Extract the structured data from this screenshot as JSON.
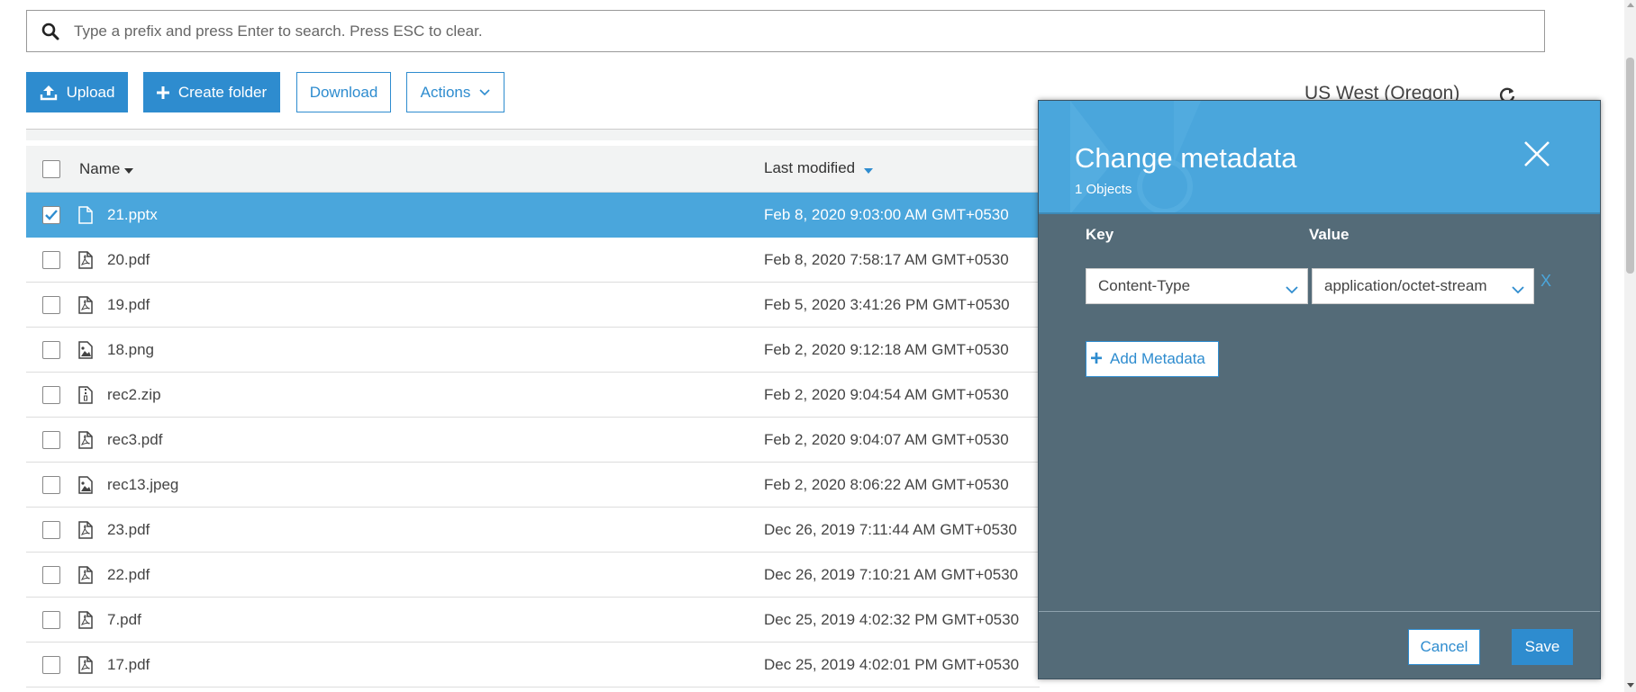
{
  "search": {
    "placeholder": "Type a prefix and press Enter to search. Press ESC to clear."
  },
  "toolbar": {
    "upload_label": "Upload",
    "create_folder_label": "Create folder",
    "download_label": "Download",
    "actions_label": "Actions"
  },
  "region": "US West (Oregon)",
  "table": {
    "headers": {
      "name": "Name",
      "last_modified": "Last modified"
    },
    "rows": [
      {
        "name": "21.pptx",
        "date": "Feb 8, 2020 9:03:00 AM GMT+0530",
        "icon": "document-icon",
        "selected": true
      },
      {
        "name": "20.pdf",
        "date": "Feb 8, 2020 7:58:17 AM GMT+0530",
        "icon": "pdf-icon",
        "selected": false
      },
      {
        "name": "19.pdf",
        "date": "Feb 5, 2020 3:41:26 PM GMT+0530",
        "icon": "pdf-icon",
        "selected": false
      },
      {
        "name": "18.png",
        "date": "Feb 2, 2020 9:12:18 AM GMT+0530",
        "icon": "image-icon",
        "selected": false
      },
      {
        "name": "rec2.zip",
        "date": "Feb 2, 2020 9:04:54 AM GMT+0530",
        "icon": "zip-icon",
        "selected": false
      },
      {
        "name": "rec3.pdf",
        "date": "Feb 2, 2020 9:04:07 AM GMT+0530",
        "icon": "pdf-icon",
        "selected": false
      },
      {
        "name": "rec13.jpeg",
        "date": "Feb 2, 2020 8:06:22 AM GMT+0530",
        "icon": "image-icon",
        "selected": false
      },
      {
        "name": "23.pdf",
        "date": "Dec 26, 2019 7:11:44 AM GMT+0530",
        "icon": "pdf-icon",
        "selected": false
      },
      {
        "name": "22.pdf",
        "date": "Dec 26, 2019 7:10:21 AM GMT+0530",
        "icon": "pdf-icon",
        "selected": false
      },
      {
        "name": "7.pdf",
        "date": "Dec 25, 2019 4:02:32 PM GMT+0530",
        "icon": "pdf-icon",
        "selected": false
      },
      {
        "name": "17.pdf",
        "date": "Dec 25, 2019 4:02:01 PM GMT+0530",
        "icon": "pdf-icon",
        "selected": false
      }
    ]
  },
  "modal": {
    "title": "Change metadata",
    "subtitle": "1 Objects",
    "key_label": "Key",
    "value_label": "Value",
    "key_value": "Content-Type",
    "value_value": "application/octet-stream",
    "remove_label": "X",
    "add_metadata_label": "Add Metadata",
    "cancel_label": "Cancel",
    "save_label": "Save"
  },
  "colors": {
    "accent": "#2e8ccf",
    "selected_row": "#4aa6dc",
    "modal_body": "#546b78",
    "modal_header": "#4aa6dc"
  }
}
